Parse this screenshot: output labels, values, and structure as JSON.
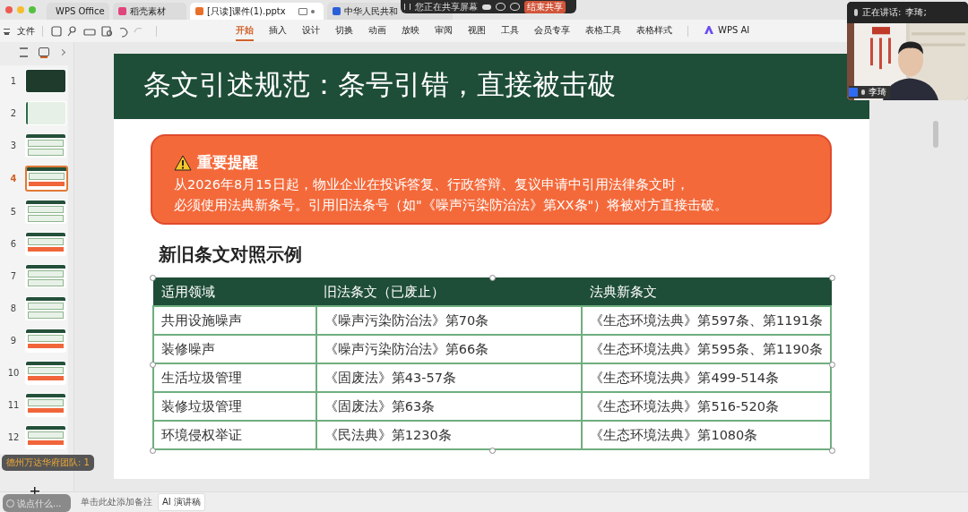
{
  "tabs": [
    {
      "label": "WPS Office",
      "kind": "wps",
      "selected": false
    },
    {
      "label": "稻壳素材",
      "kind": "docer",
      "selected": false
    },
    {
      "label": "[只读]课件(1).pptx",
      "kind": "ppt",
      "selected": true
    },
    {
      "label": "中华人民共和",
      "kind": "word",
      "selected": false
    }
  ],
  "share_bar": {
    "status": "您正在共享屏幕",
    "stop_button": "结束共享"
  },
  "toolbar": {
    "file_menu": "文件"
  },
  "ribbon_tabs": [
    {
      "label": "开始",
      "selected": true
    },
    {
      "label": "插入",
      "selected": false
    },
    {
      "label": "设计",
      "selected": false
    },
    {
      "label": "切换",
      "selected": false
    },
    {
      "label": "动画",
      "selected": false
    },
    {
      "label": "放映",
      "selected": false
    },
    {
      "label": "审阅",
      "selected": false
    },
    {
      "label": "视图",
      "selected": false
    },
    {
      "label": "工具",
      "selected": false
    },
    {
      "label": "会员专享",
      "selected": false
    },
    {
      "label": "表格工具",
      "selected": false
    },
    {
      "label": "表格样式",
      "selected": false
    }
  ],
  "ai_button": "WPS AI",
  "video": {
    "speaking_label": "正在讲话:",
    "speaker": "李琦;",
    "name_tag": "李琦"
  },
  "thumbnails": [
    {
      "number": "1",
      "kind": "dark",
      "selected": false
    },
    {
      "number": "2",
      "kind": "light",
      "selected": false
    },
    {
      "number": "3",
      "kind": "cards",
      "selected": false
    },
    {
      "number": "4",
      "kind": "alert",
      "selected": true
    },
    {
      "number": "5",
      "kind": "cards",
      "selected": false
    },
    {
      "number": "6",
      "kind": "alert",
      "selected": false
    },
    {
      "number": "7",
      "kind": "cards",
      "selected": false
    },
    {
      "number": "8",
      "kind": "cards",
      "selected": false
    },
    {
      "number": "9",
      "kind": "alert",
      "selected": false
    },
    {
      "number": "10",
      "kind": "alert",
      "selected": false
    },
    {
      "number": "11",
      "kind": "alert",
      "selected": false
    },
    {
      "number": "12",
      "kind": "alert",
      "selected": false
    }
  ],
  "chat_toast": "德州万达华府团队: 1",
  "chat_input": {
    "placeholder": "说点什么..."
  },
  "slide": {
    "title": "条文引述规范：条号引错，直接被击破",
    "alert": {
      "title": "重要提醒",
      "lines": [
        "从2026年8月15日起，物业企业在投诉答复、行政答辩、复议申请中引用法律条文时，",
        "必须使用法典新条号。引用旧法条号（如\"《噪声污染防治法》第XX条\"）将被对方直接击破。"
      ]
    },
    "subtitle": "新旧条文对照示例",
    "table": {
      "columns": [
        "适用领域",
        "旧法条文（已废止）",
        "法典新条文"
      ],
      "rows": [
        [
          "共用设施噪声",
          "《噪声污染防治法》第70条",
          "《生态环境法典》第597条、第1191条"
        ],
        [
          "装修噪声",
          "《噪声污染防治法》第66条",
          "《生态环境法典》第595条、第1190条"
        ],
        [
          "生活垃圾管理",
          "《固废法》第43-57条",
          "《生态环境法典》第499-514条"
        ],
        [
          "装修垃圾管理",
          "《固废法》第63条",
          "《生态环境法典》第516-520条"
        ],
        [
          "环境侵权举证",
          "《民法典》第1230条",
          "《生态环境法典》第1080条"
        ]
      ]
    }
  },
  "notes": {
    "placeholder": "单击此处添加备注",
    "ai_button": "AI 演讲稿"
  }
}
